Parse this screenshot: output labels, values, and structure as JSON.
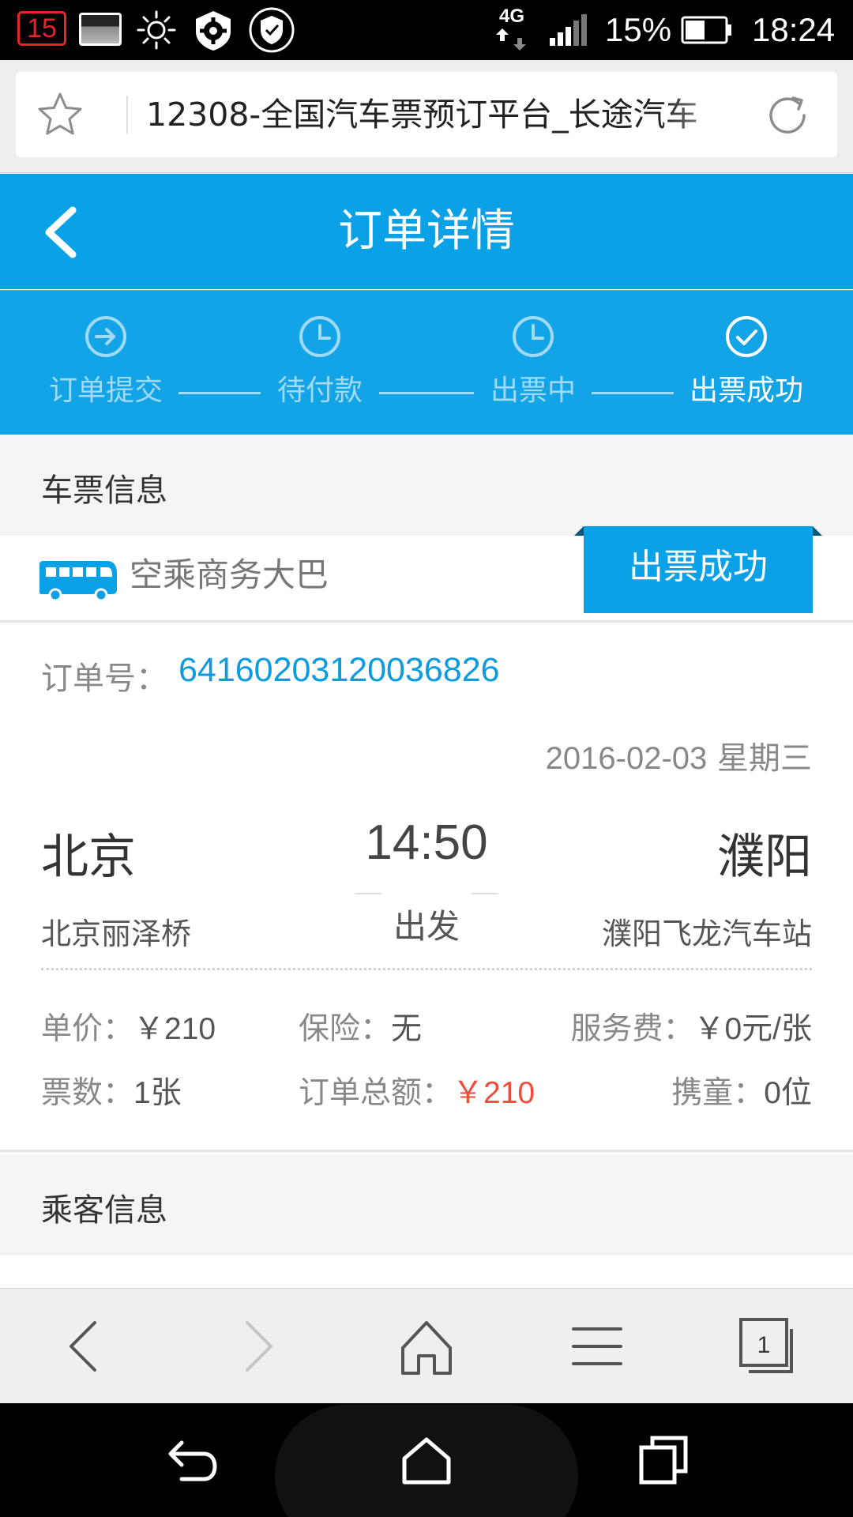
{
  "status_bar": {
    "badge": "15",
    "network": "4G",
    "battery_percent": "15%",
    "battery_level": 0.15,
    "time": "18:24",
    "icons": [
      "notification-badge-icon",
      "image-icon",
      "brightness-icon",
      "gear-icon",
      "shield-icon",
      "network-4g-icon",
      "signal-icon",
      "battery-icon"
    ]
  },
  "browser": {
    "page_title": "12308-全国汽车票预订平台_长途汽车",
    "icons": [
      "star-icon",
      "refresh-icon"
    ]
  },
  "header": {
    "title": "订单详情",
    "back_icon": "chevron-left-icon"
  },
  "progress_steps": [
    {
      "label": "订单提交",
      "icon": "arrow-circle-icon",
      "active": false
    },
    {
      "label": "待付款",
      "icon": "clock-icon",
      "active": false
    },
    {
      "label": "出票中",
      "icon": "clock-icon",
      "active": false
    },
    {
      "label": "出票成功",
      "icon": "check-circle-icon",
      "active": true
    }
  ],
  "ticket_section": {
    "title": "车票信息",
    "bus_type": "空乘商务大巴",
    "status": "出票成功",
    "order_label": "订单号：",
    "order_no": "64160203120036826",
    "date": "2016-02-03",
    "weekday": "星期三",
    "from_city": "北京",
    "from_station": "北京丽泽桥",
    "depart_time": "14:50",
    "depart_label": "出发",
    "to_city": "濮阳",
    "to_station": "濮阳飞龙汽车站",
    "fees": {
      "unit_price_label": "单价：",
      "unit_price": "￥210",
      "insurance_label": "保险：",
      "insurance": "无",
      "service_fee_label": "服务费：",
      "service_fee": "￥0元/张",
      "ticket_count_label": "票数：",
      "ticket_count": "1张",
      "total_label": "订单总额：",
      "total": "￥210",
      "children_label": "携童：",
      "children": "0位"
    }
  },
  "passenger_section": {
    "title": "乘客信息"
  },
  "toolbar": {
    "tabs_count": "1",
    "icons": [
      "back-icon",
      "forward-icon",
      "home-icon",
      "menu-icon",
      "tabs-icon"
    ]
  },
  "nav_bar": {
    "icons": [
      "back-icon",
      "home-icon",
      "recents-icon"
    ]
  },
  "colors": {
    "accent": "#0aa1e6",
    "order_no": "#0a9be0",
    "total": "#f24b3c"
  }
}
